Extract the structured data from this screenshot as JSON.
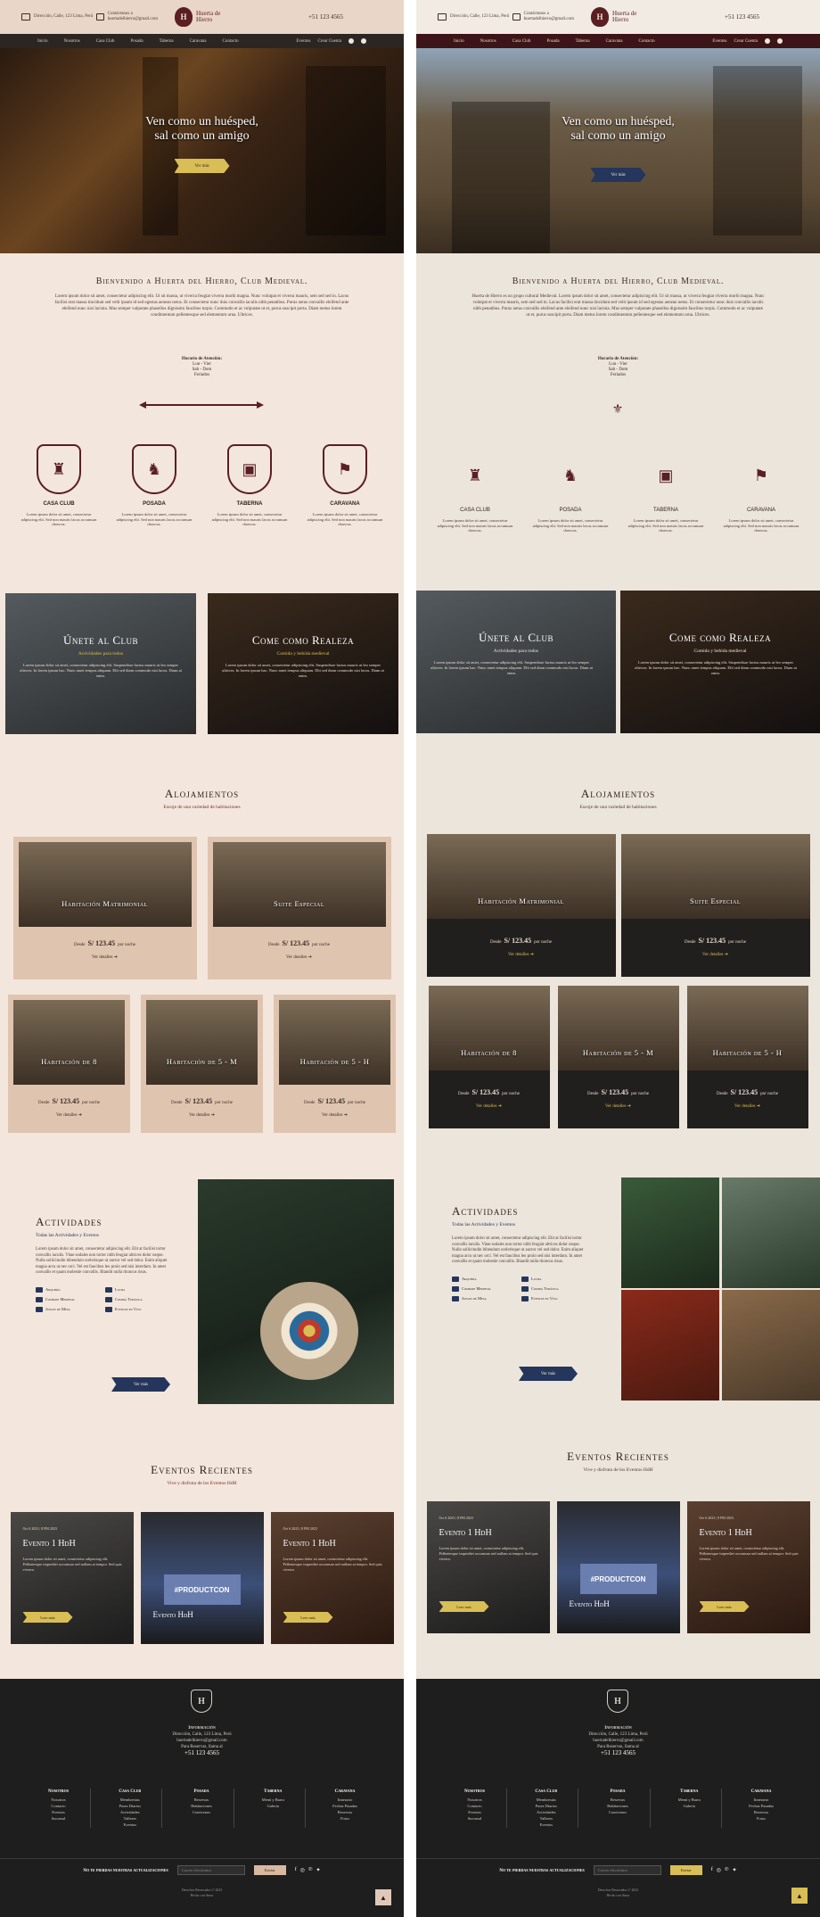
{
  "site": {
    "address": "Dirección, Calle, 123 Lima, Perú",
    "email": "Contáctanos a huertadelhierro@gmail.com",
    "logo_text": "Huerta de Hierro",
    "phone": "+51 123 4565"
  },
  "nav": [
    "Inicio",
    "Nosotros",
    "Casa Club",
    "Posada",
    "Taberna",
    "Caravana",
    "Contacto",
    "Eventos",
    "Crear Cuenta"
  ],
  "hero": {
    "title_line1": "Ven como un huésped,",
    "title_line2": "sal como un amigo",
    "button": "Ver más"
  },
  "welcome": {
    "title": "Bienvenido a Huerta del Hierro, Club Medieval.",
    "text": "Lorem ipsum dolor sit amet, consectetur adipiscing elit. Ut sit massa, ut viverra feugiat viverra morbi magna. Nunc volutpat et viverra mauris, sem sed sed in. Lacus facilisi erat massa tincidunt sed velit ipsum id sed egestas aenean netus. Et consectetur nunc duis convallis iaculis nibh penatibus. Purus netus convallis eleifend ante eleifend nunc nisi lacinia. Mus semper vulputate phasellus dignissim faucibus turpis. Commodo et ac vulputate ut et, purus suscipit porta. Diam metus lorem condimentum pellentesque sed elementum urna. Ultrices.",
    "text_right": "Huerta de Hierro es un grupo cultural Medieval. Lorem ipsum dolor sit amet, consectetur adipiscing elit. Ut sit massa, ut viverra feugiat viverra morbi magna. Nunc volutpat et viverra mauris, sem sed sed in. Lacus facilisi erat massa tincidunt sed velit ipsum id sed egestas aenean netus. Et consectetur nunc duis convallis iaculis nibh penatibus. Purus netus convallis eleifend ante eleifend nunc nisi lacinia. Mus semper vulputate phasellus dignissim faucibus turpis. Commodo et ac vulputate ut et, purus suscipit porta. Diam metus lorem condimentum pellentesque sed elementum urna. Ultrices.",
    "hours_label": "Horario de Atención:",
    "hours_line1": "Lun - Vier",
    "hours_line2": "Sab - Dom",
    "hours_line3": "Feriados"
  },
  "amenities": [
    {
      "title": "CASA CLUB",
      "icon": "castle-icon",
      "desc": "Lorem ipsum dolor sit amet, consectetur adipiscing elit. Sed non mauris lacus accumsan rhoncus."
    },
    {
      "title": "POSADA",
      "icon": "bed-icon",
      "desc": "Lorem ipsum dolor sit amet, consectetur adipiscing elit. Sed non mauris lacus accumsan rhoncus."
    },
    {
      "title": "TABERNA",
      "icon": "barrel-icon",
      "desc": "Lorem ipsum dolor sit amet, consectetur adipiscing elit. Sed non mauris lacus accumsan rhoncus."
    },
    {
      "title": "CARAVANA",
      "icon": "banner-icon",
      "desc": "Lorem ipsum dolor sit amet, consectetur adipiscing elit. Sed non mauris lacus accumsan rhoncus."
    }
  ],
  "promos": [
    {
      "title": "Únete al Club",
      "sub": "Actividades para todos",
      "desc": "Lorem ipsum dolor sit amet, consectetur adipiscing elit. Suspendisse luctus mauris ut leo semper ultrices. In lorem ipsum hac. Nunc amet tempus aliquam. Elit sed diam commodo nisi lacus. Diam at enim."
    },
    {
      "title": "Come como Realeza",
      "sub": "Comida y bebida medieval",
      "desc": "Lorem ipsum dolor sit amet, consectetur adipiscing elit. Suspendisse luctus mauris ut leo semper ultrices. In lorem ipsum hac. Nunc amet tempus aliquam. Elit sed diam commodo nisi lacus. Diam at enim."
    }
  ],
  "rooms_section": {
    "title": "Alojamientos",
    "sub": "Escoje de una variedad de habitaciones"
  },
  "rooms_big": [
    {
      "title": "Habitación Matrimonial",
      "from": "Desde",
      "price": "S/ 123.45",
      "per": "por noche",
      "link": "Ver detalles"
    },
    {
      "title": "Suite Especial",
      "from": "Desde",
      "price": "S/ 123.45",
      "per": "por noche",
      "link": "Ver detalles"
    }
  ],
  "rooms_small": [
    {
      "title": "Habitación de 8",
      "from": "Desde",
      "price": "S/ 123.45",
      "per": "por noche",
      "link": "Ver detalles"
    },
    {
      "title": "Habitación de 5 - M",
      "from": "Desde",
      "price": "S/ 123.45",
      "per": "por noche",
      "link": "Ver detalles"
    },
    {
      "title": "Habitación de 5 - H",
      "from": "Desde",
      "price": "S/ 123.45",
      "per": "por noche",
      "link": "Ver detalles"
    }
  ],
  "activities": {
    "title": "Actividades",
    "sub": "Todas las Actividades y Eventos",
    "desc": "Lorem ipsum dolor sit amet, consectetur adipiscing elit. Elit at facilisi tortor convallis iaculis. Vitae sodales non tortor nibh feugiat ultrices dolor neque. Nulla sollicitudin bibendum scelerisque ut auctor vel sed dolor. Enim aliquet magna arcu ut nec orci. Vel est faucibus leo proin sed nisi interdum. In amet convallis et quam molestie convallis. Blandit nulla rhoncus risus.",
    "items": [
      "Arquería",
      "Lucha",
      "Combate Medieval",
      "Comida Temática",
      "Juegos de Mesa",
      "Eventos en Vivo"
    ],
    "button": "Ver más"
  },
  "events_section": {
    "title": "Eventos Recientes",
    "sub": "Vive y disfruta de los Eventos HdH"
  },
  "events": [
    {
      "date": "Oct 6 2023 | 8 PM 2023",
      "title": "Evento 1 HdH",
      "desc": "Lorem ipsum dolor sit amet, consectetur adipiscing elit. Pellentesque imperdiet accumsan sed nullam at tempor. Sed quis viverra.",
      "button": "Leer más"
    },
    {
      "title": "Evento HdH",
      "screen": "#PRODUCTCON"
    },
    {
      "date": "Oct 6 2023 | 8 PM 2023",
      "title": "Evento 1 HdH",
      "desc": "Lorem ipsum dolor sit amet, consectetur adipiscing elit. Pellentesque imperdiet accumsan sed nullam at tempor. Sed quis viverra.",
      "button": "Leer más"
    }
  ],
  "footer": {
    "info_label": "Información",
    "address": "Dirección, Calle, 123 Lima, Perú",
    "email": "huertadelhierro@gmail.com",
    "reservations": "Para Reservas, llama al",
    "phone": "+51 123 4565",
    "columns": [
      {
        "title": "Nosotros",
        "items": [
          "Nosotros",
          "Contacto",
          "Eventos",
          "Sucursal"
        ]
      },
      {
        "title": "Casa Club",
        "items": [
          "Membresías",
          "Pases Diarios",
          "Actividades",
          "Talleres",
          "Eventos"
        ]
      },
      {
        "title": "Posada",
        "items": [
          "Reservas",
          "Habitaciones",
          "Conócenos"
        ]
      },
      {
        "title": "Taberna",
        "items": [
          "Menú y Barra",
          "Galería"
        ]
      },
      {
        "title": "Caravana",
        "items": [
          "Itinerario",
          "Fechas Pasadas",
          "Reservas",
          "Fotos"
        ]
      }
    ],
    "newsletter_label": "No te pierdas nuestras actualizaciones",
    "newsletter_placeholder": "Correo electrónico",
    "newsletter_button": "Enviar",
    "copyright": "Derechos Reservados © 2023",
    "made_by": "Hecho con Amor",
    "up_icon": "arrow-up-icon"
  },
  "colors": {
    "burgundy": "#5a1e23",
    "gold": "#d9be55",
    "navy": "#24365c",
    "footer": "#1e1e1e"
  }
}
